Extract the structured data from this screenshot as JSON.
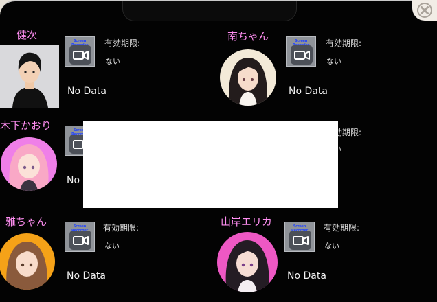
{
  "close_icon": "close-x-icon",
  "camera_icon": "video-camera-icon",
  "camera_brand": "Screen Recorder",
  "characters": [
    {
      "name": "健次",
      "expiry_label": "有効期限:",
      "expiry_value": "ない",
      "data": "No Data",
      "avatar_bg": "#d9d9dc"
    },
    {
      "name": "南ちゃん",
      "expiry_label": "有効期限:",
      "expiry_value": "ない",
      "data": "No Data",
      "avatar_bg": "#f3ead8"
    },
    {
      "name": "木下かおり",
      "expiry_label": "",
      "expiry_value": "",
      "data": "No",
      "avatar_bg": "#ef7fe8"
    },
    {
      "name": "",
      "expiry_label": "有効期限:",
      "expiry_value": "ない",
      "data": "",
      "avatar_bg": ""
    },
    {
      "name": "雅ちゃん",
      "expiry_label": "有効期限:",
      "expiry_value": "ない",
      "data": "No Data",
      "avatar_bg": "#f5a218"
    },
    {
      "name": "山岸エリカ",
      "expiry_label": "有効期限:",
      "expiry_value": "ない",
      "data": "No Data",
      "avatar_bg": "#ee58c4"
    }
  ]
}
